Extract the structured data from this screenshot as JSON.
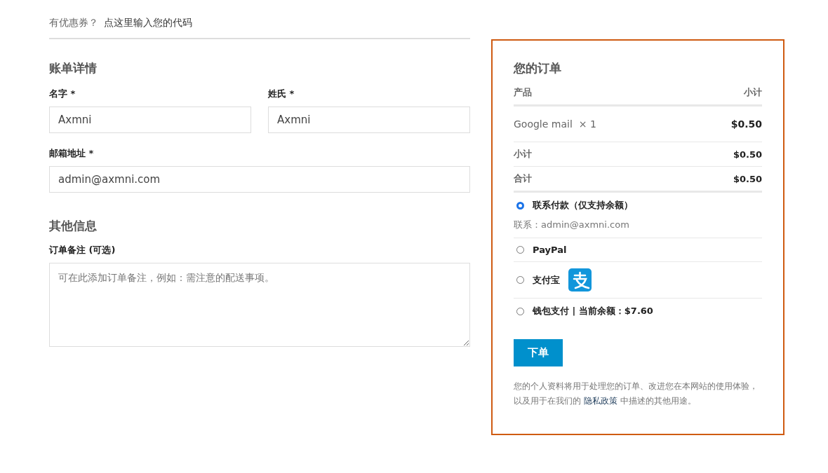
{
  "coupon": {
    "prompt": "有优惠券？",
    "link": "点这里输入您的代码"
  },
  "billing": {
    "title": "账单详情",
    "fields": [
      {
        "kind": "half",
        "label": "名字 *",
        "value": "Axmni"
      },
      {
        "kind": "half",
        "label": "姓氏 *",
        "value": "Axmni"
      },
      {
        "kind": "full",
        "label": "邮箱地址 *",
        "value": "admin@axmni.com"
      }
    ]
  },
  "additional": {
    "title": "其他信息",
    "notes_label": "订单备注 (可选)",
    "notes_placeholder": "可在此添加订单备注，例如：需注意的配送事项。"
  },
  "order": {
    "title": "您的订单",
    "columns": [
      "产品",
      "小计"
    ],
    "items": [
      {
        "name": "Google mail",
        "qty": "× 1",
        "total": "$0.50"
      }
    ],
    "totals": [
      {
        "label": "小计",
        "value": "$0.50"
      },
      {
        "label": "合计",
        "value": "$0.50"
      }
    ],
    "payment_methods": [
      {
        "kind": "plain",
        "label": "联系付款（仅支持余额）",
        "selected": true,
        "description": "联系：admin@axmni.com"
      },
      {
        "kind": "plain",
        "label": "PayPal",
        "selected": false
      },
      {
        "kind": "alipay",
        "label": "支付宝",
        "selected": false
      },
      {
        "kind": "plain",
        "label": "钱包支付 | 当前余额：$7.60",
        "selected": false
      }
    ],
    "place_order": "下单",
    "privacy": {
      "before": "您的个人资料将用于处理您的订单、改进您在本网站的使用体验，以及用于在我们的",
      "link": "隐私政策",
      "after": "中描述的其他用途。"
    }
  }
}
